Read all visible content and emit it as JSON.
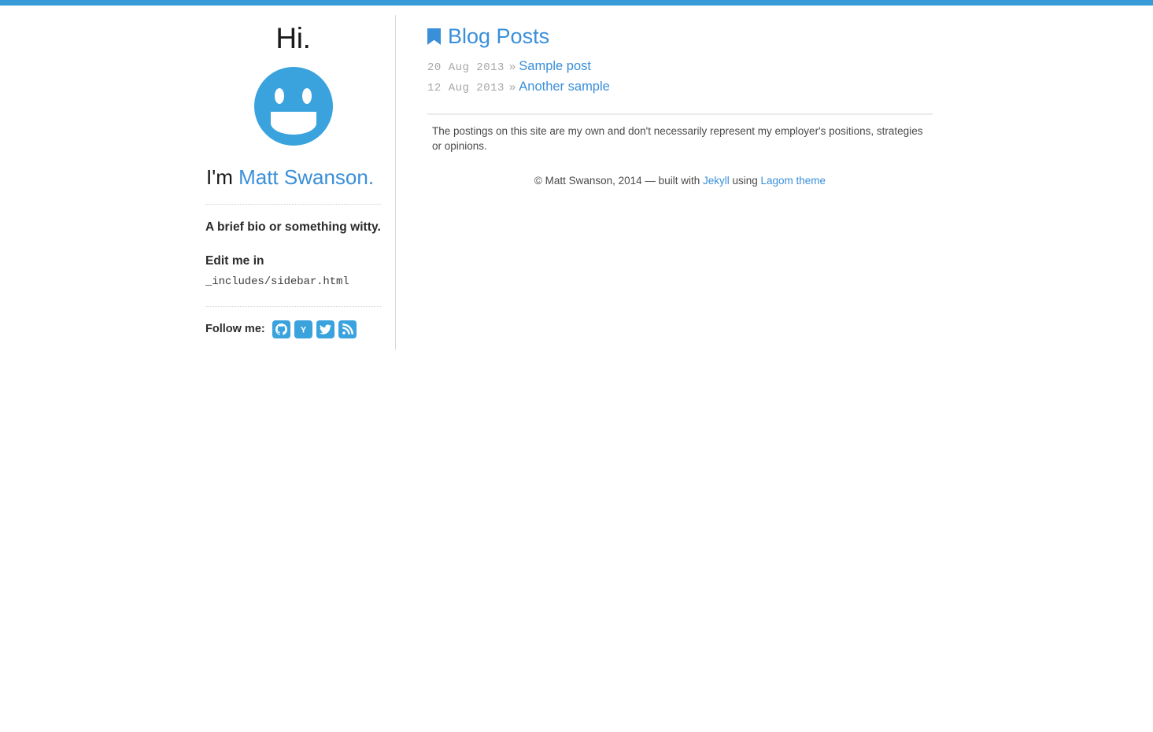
{
  "theme": {
    "accent": "#369bd7",
    "icon_blue": "#3aa3dd",
    "link_blue": "#3a8fd9",
    "text_dark": "#1a1a1a",
    "muted_gray": "#a6a6a6",
    "rule_gray": "#ececec"
  },
  "sidebar": {
    "greeting": "Hi.",
    "avatar_icon": "smiley-face-icon",
    "intro_prefix": "I'm ",
    "name": "Matt Swanson",
    "intro_suffix": ".",
    "bio_line": "A brief bio or something witty.",
    "edit_label": "Edit me in",
    "edit_path": "_includes/sidebar.html",
    "follow_label": "Follow me:",
    "social_links": [
      {
        "name": "github-icon",
        "label": "GitHub"
      },
      {
        "name": "hacker-news-icon",
        "label": "Hacker News"
      },
      {
        "name": "twitter-icon",
        "label": "Twitter"
      },
      {
        "name": "rss-icon",
        "label": "RSS"
      }
    ]
  },
  "main": {
    "section_icon": "bookmark-icon",
    "section_title": "Blog Posts",
    "posts": [
      {
        "date": "20 Aug 2013",
        "separator": "»",
        "title": "Sample post"
      },
      {
        "date": "12 Aug 2013",
        "separator": "»",
        "title": "Another sample"
      }
    ],
    "disclaimer": "The postings on this site are my own and don't necessarily represent my employer's positions, strategies or opinions.",
    "footer": {
      "copyright_prefix": "© Matt Swanson, 2014 — built with ",
      "engine_link": "Jekyll",
      "middle": " using ",
      "theme_link": "Lagom theme"
    }
  }
}
